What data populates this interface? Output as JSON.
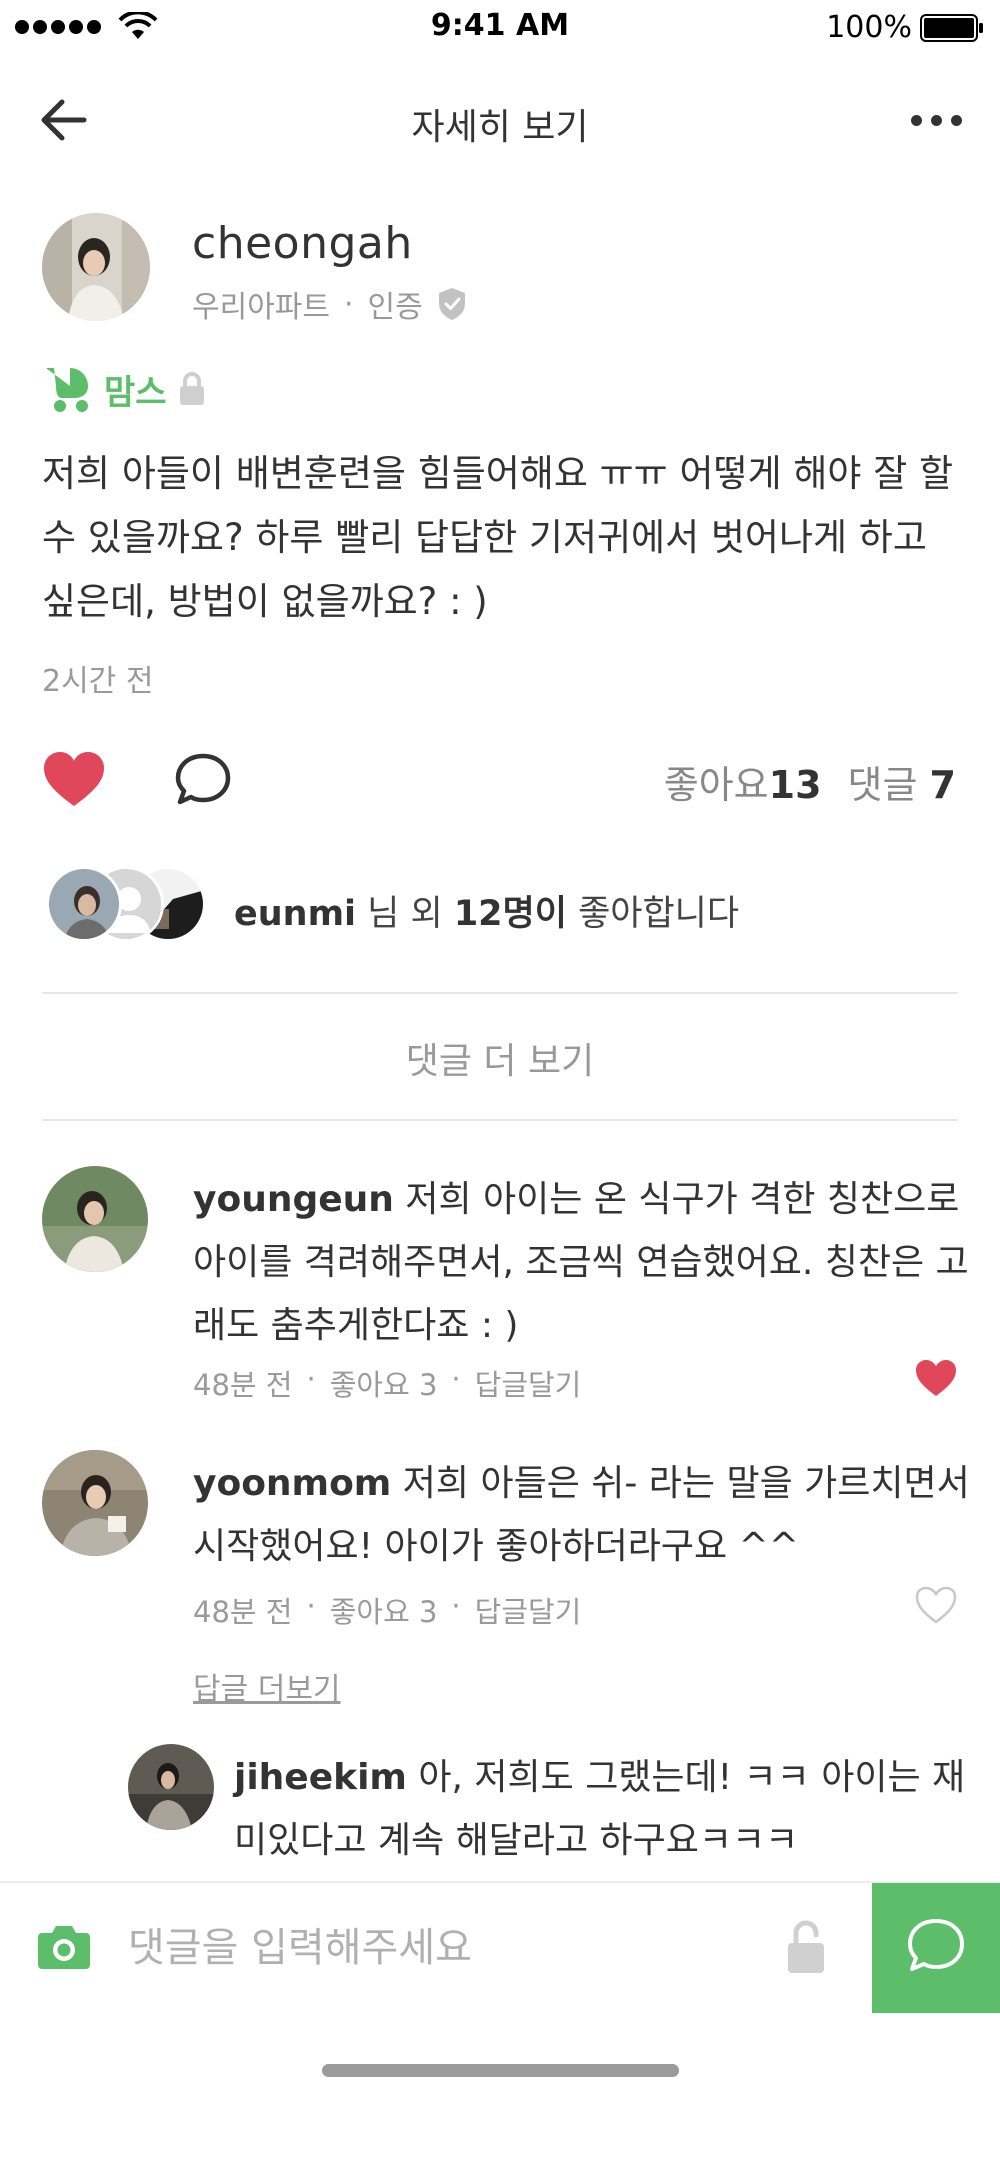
{
  "status_bar": {
    "time": "9:41 AM",
    "battery": "100%"
  },
  "nav": {
    "title": "자세히 보기"
  },
  "post": {
    "author": {
      "name": "cheongah",
      "community": "우리아파트",
      "separator": "·",
      "badge": "인증"
    },
    "category": "맘스",
    "body": "저희 아들이 배변훈련을 힘들어해요 ㅠㅠ 어떻게 해야 잘 할 수 있을까요? 하루 빨리 답답한 기저귀에서 벗어나게 하고 싶은데, 방법이 없을까요? : )",
    "time": "2시간 전",
    "likes_label": "좋아요",
    "likes_count": "13",
    "comments_label": "댓글",
    "comments_count": "7",
    "likers": {
      "first": "eunmi",
      "mid": " 님 외 ",
      "others": "12명이",
      "tail": " 좋아합니다"
    }
  },
  "more_comments_label": "댓글 더 보기",
  "comments": [
    {
      "user": "youngeun",
      "text": " 저희 아이는 온 식구가 격한 칭찬으로 아이를 격려해주면서, 조금씩 연습했어요. 칭찬은 고래도 춤추게한다죠 : )",
      "time": "48분 전",
      "likes": "좋아요 3",
      "reply": "답글달기",
      "sep": "·",
      "liked": true
    },
    {
      "user": "yoonmom",
      "text": " 저희 아들은 쉬- 라는 말을 가르치면서 시작했어요! 아이가 좋아하더라구요 ^^",
      "time": "48분 전",
      "likes": "좋아요 3",
      "reply": "답글달기",
      "sep": "·",
      "liked": false
    }
  ],
  "reply_more_label": "답글 더보기",
  "reply": {
    "user": "jiheekim",
    "text": " 아, 저희도 그랬는데! ㅋㅋ 아이는 재미있다고 계속 해달라고 하구요ㅋㅋㅋ"
  },
  "input": {
    "placeholder": "댓글을 입력해주세요"
  },
  "colors": {
    "accent": "#5cbd6a",
    "like": "#e0475b",
    "muted": "#999999"
  },
  "icons": [
    "back-arrow-icon",
    "more-icon",
    "verified-shield-icon",
    "stroller-icon",
    "lock-icon",
    "heart-icon",
    "comment-bubble-icon",
    "camera-icon",
    "unlock-icon",
    "send-bubble-icon"
  ]
}
